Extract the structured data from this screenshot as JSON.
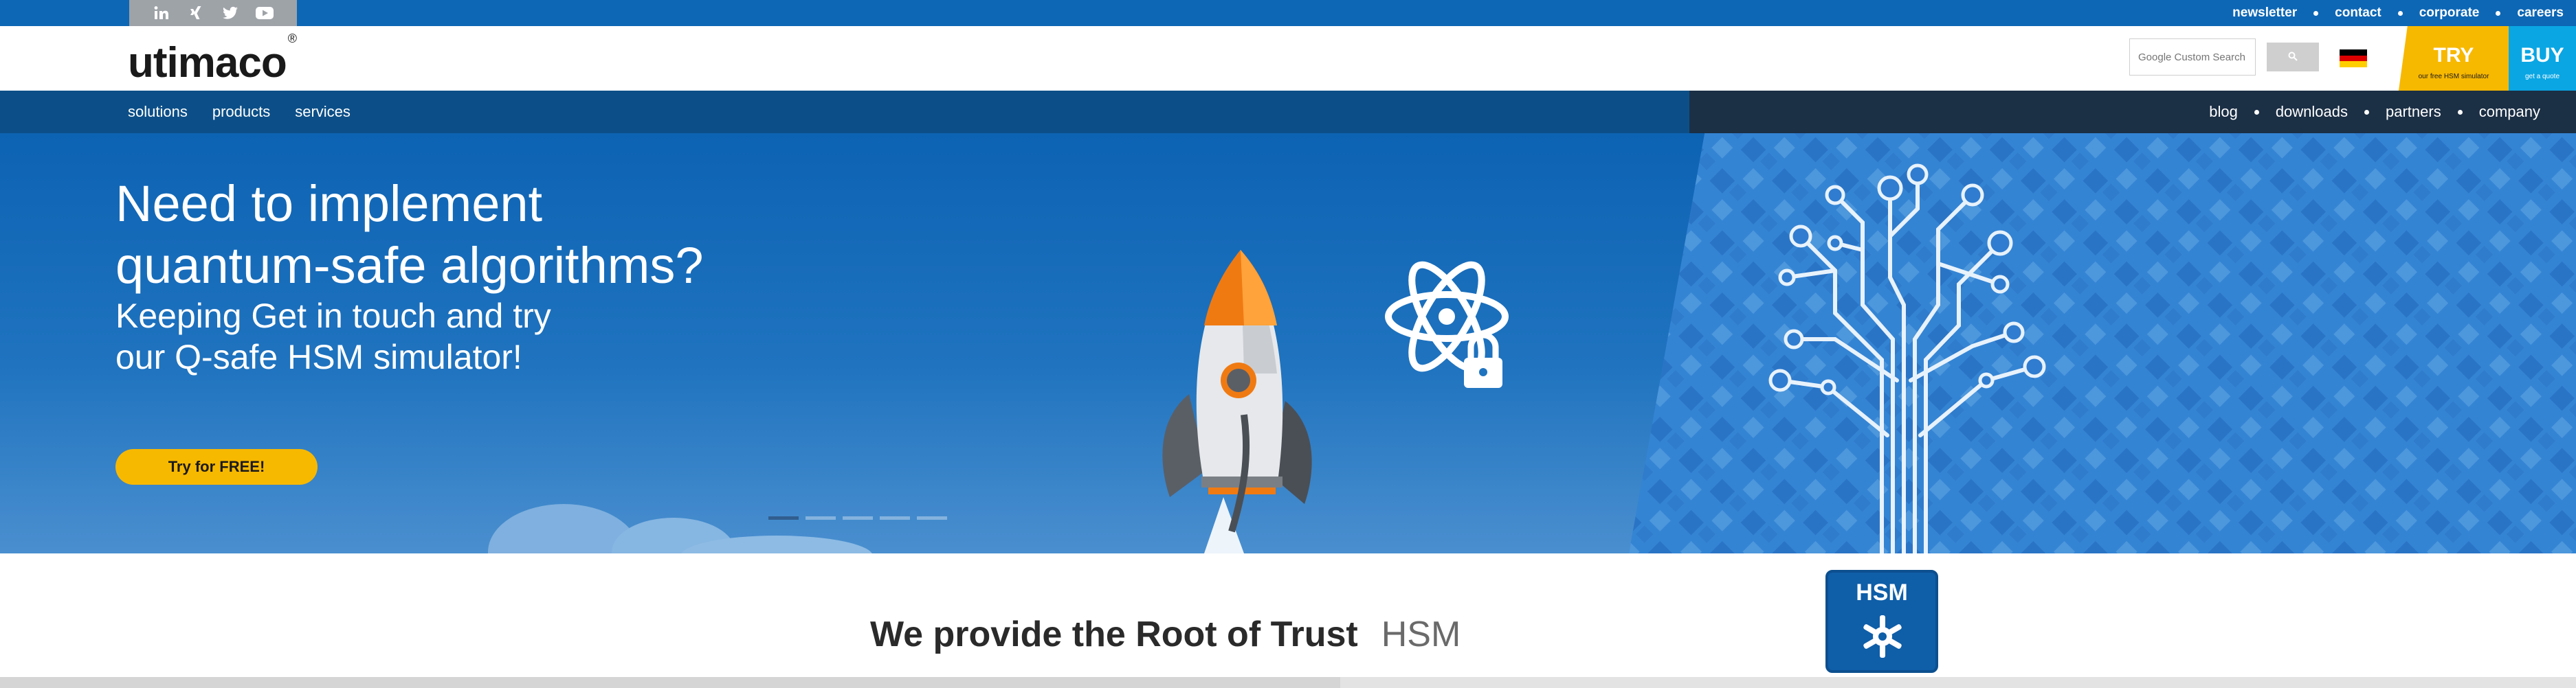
{
  "topbar": {
    "social_icons": [
      "linkedin-icon",
      "xing-icon",
      "twitter-icon",
      "youtube-icon"
    ],
    "links": [
      "newsletter",
      "contact",
      "corporate",
      "careers"
    ]
  },
  "header": {
    "logo_text": "utimaco",
    "logo_mark": "®",
    "search": {
      "placeholder": "Google Custom Search"
    },
    "language_flag": "german-flag",
    "try": {
      "label": "TRY",
      "sub": "our free HSM simulator"
    },
    "buy": {
      "label": "BUY",
      "sub": "get a quote"
    }
  },
  "nav": {
    "left": [
      "solutions",
      "products",
      "services"
    ],
    "right": [
      "blog",
      "downloads",
      "partners",
      "company"
    ]
  },
  "hero": {
    "title_line1": "Need to implement",
    "title_line2": "quantum-safe algorithms?",
    "sub_line1": "Keeping Get in touch and try",
    "sub_line2": "our Q-safe HSM simulator!",
    "cta": "Try for FREE!",
    "slides": 5,
    "active_slide": 1
  },
  "section": {
    "lead": "We provide the Root of Trust",
    "word": "HSM",
    "hsm_box_label": "HSM"
  },
  "colors": {
    "brand_blue": "#0d67b5",
    "nav_blue": "#0c4f88",
    "accent_yellow": "#f7b800",
    "accent_cyan": "#0aa6e4",
    "rocket_orange": "#f07a12"
  }
}
